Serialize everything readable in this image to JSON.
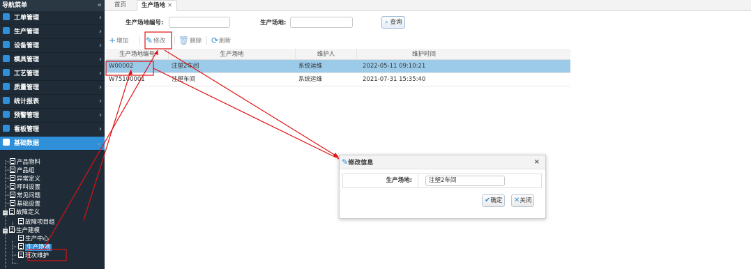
{
  "sidebar": {
    "title": "导航菜单",
    "collapse_glyph": "«",
    "menu": [
      {
        "label": "工单管理",
        "color": "#2f8fd8"
      },
      {
        "label": "生产管理",
        "color": "#2f8fd8"
      },
      {
        "label": "设备管理",
        "color": "#2f8fd8"
      },
      {
        "label": "模具管理",
        "color": "#2f8fd8"
      },
      {
        "label": "工艺管理",
        "color": "#2f8fd8"
      },
      {
        "label": "质量管理",
        "color": "#2f8fd8"
      },
      {
        "label": "统计报表",
        "color": "#2f8fd8"
      },
      {
        "label": "预警管理",
        "color": "#2f8fd8"
      },
      {
        "label": "看板管理",
        "color": "#2f8fd8"
      },
      {
        "label": "基础数据",
        "color": "#ffffff"
      }
    ],
    "tree": [
      "产品物料",
      "产品组",
      "异常定义",
      "呼叫设置",
      "常见问题",
      "基础设置",
      "故障定义",
      "故障项目组",
      "生产建模",
      "生产中心",
      "生产场地",
      "班次维护"
    ]
  },
  "tabs": {
    "home": "首页",
    "active": "生产场地",
    "close": "×"
  },
  "search": {
    "code_label": "生产场地编号:",
    "site_label": "生产场地:",
    "query_label": "查询"
  },
  "toolbar": {
    "add": "增加",
    "edit": "修改",
    "delete": "删除",
    "refresh": "刷新"
  },
  "grid": {
    "headers": [
      "生产场地编号",
      "生产场地",
      "维护人",
      "维护时间"
    ],
    "rows": [
      [
        "W00002",
        "注塑2车间",
        "系统运维",
        "2022-05-11 09:10:21"
      ],
      [
        "W75100001",
        "注塑车间",
        "系统运维",
        "2021-07-31 15:35:40"
      ]
    ]
  },
  "dialog": {
    "title": "修改信息",
    "close": "×",
    "field_label": "生产场地:",
    "field_value": "注塑2车间",
    "ok": "确定",
    "cancel": "关闭"
  },
  "colors": {
    "accent": "#2f8fd8",
    "sidebar_bg": "#1f2c37",
    "selected_row": "#9ccbea",
    "annotation": "#e01010"
  }
}
